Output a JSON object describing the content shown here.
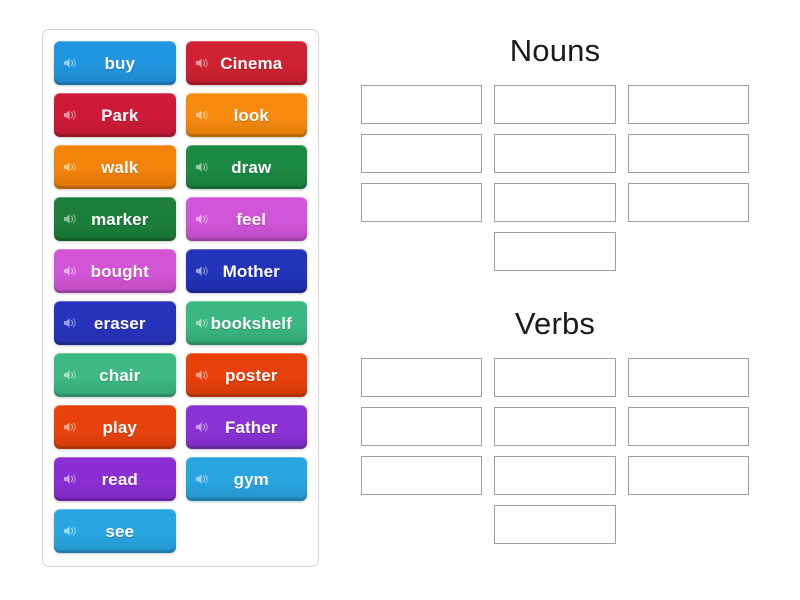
{
  "page": {
    "background": "#ffffff",
    "activity_type": "group-sort"
  },
  "word_bank": {
    "name": "word-tile-panel",
    "icon_name": "speaker-icon",
    "tiles": [
      {
        "label": "buy",
        "color": "#2196e0"
      },
      {
        "label": "Cinema",
        "color": "#cf2232"
      },
      {
        "label": "Park",
        "color": "#cf1b38"
      },
      {
        "label": "look",
        "color": "#f68a0e"
      },
      {
        "label": "walk",
        "color": "#f3830b"
      },
      {
        "label": "draw",
        "color": "#1c8a42"
      },
      {
        "label": "marker",
        "color": "#1b7f39"
      },
      {
        "label": "feel",
        "color": "#d155d8"
      },
      {
        "label": "bought",
        "color": "#d355d6"
      },
      {
        "label": "Mother",
        "color": "#2233ba"
      },
      {
        "label": "eraser",
        "color": "#2733bd"
      },
      {
        "label": "bookshelf",
        "color": "#3ab783"
      },
      {
        "label": "chair",
        "color": "#3cb984"
      },
      {
        "label": "poster",
        "color": "#e8400b"
      },
      {
        "label": "play",
        "color": "#ea420c"
      },
      {
        "label": "Father",
        "color": "#8a32d6"
      },
      {
        "label": "read",
        "color": "#8b2ed4"
      },
      {
        "label": "gym",
        "color": "#28a5e0"
      },
      {
        "label": "see",
        "color": "#29a6e2"
      }
    ]
  },
  "categories": [
    {
      "title": "Nouns",
      "slot_count": 10,
      "slots": [
        "",
        "",
        "",
        "",
        "",
        "",
        "",
        "",
        "",
        ""
      ]
    },
    {
      "title": "Verbs",
      "slot_count": 10,
      "slots": [
        "",
        "",
        "",
        "",
        "",
        "",
        "",
        "",
        "",
        ""
      ]
    }
  ]
}
